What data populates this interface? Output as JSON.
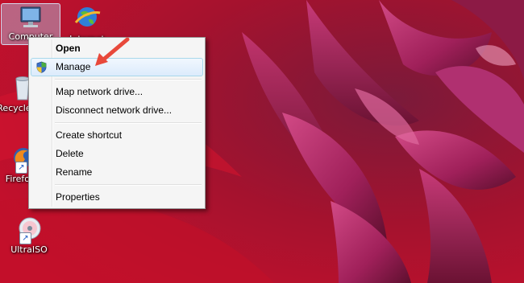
{
  "desktop": {
    "icons": [
      {
        "label": "Computer"
      },
      {
        "label": "Internet"
      },
      {
        "label": "Recycle Bin"
      },
      {
        "label": "Firefox"
      },
      {
        "label": "UltraISO"
      }
    ]
  },
  "context_menu": {
    "items": [
      {
        "label": "Open"
      },
      {
        "label": "Manage",
        "icon": "uac-shield-icon"
      },
      {
        "label": "Map network drive..."
      },
      {
        "label": "Disconnect network drive..."
      },
      {
        "label": "Create shortcut"
      },
      {
        "label": "Delete"
      },
      {
        "label": "Rename"
      },
      {
        "label": "Properties"
      }
    ]
  },
  "annotation": {
    "color": "#e8493b"
  }
}
